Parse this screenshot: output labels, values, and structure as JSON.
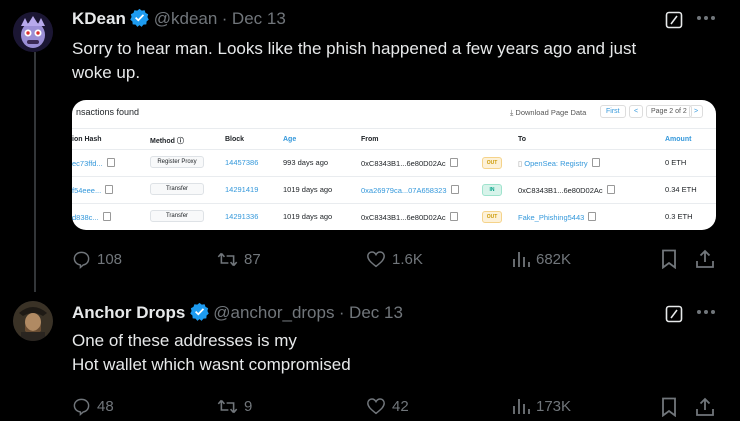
{
  "tweet1": {
    "name": "KDean",
    "handle": "@kdean",
    "separator": "·",
    "date": "Dec 13",
    "text_line1": "Sorry to hear man. Looks like the phish happened a few years ago and just",
    "text_line2": "woke up.",
    "replies": "108",
    "retweets": "87",
    "likes": "1.6K",
    "views": "682K"
  },
  "tweet2": {
    "name": "Anchor Drops",
    "handle": "@anchor_drops",
    "separator": "·",
    "date": "Dec 13",
    "text_line1": "One of these addresses is my",
    "text_line2": "Hot wallet which wasnt compromised",
    "replies": "48",
    "retweets": "9",
    "likes": "42",
    "views": "173K"
  },
  "embed": {
    "title": "nsactions found",
    "download": "Download Page Data",
    "first": "First",
    "prev": "<",
    "page": "Page 2 of 2",
    "next": ">",
    "headers": {
      "hash": "ion Hash",
      "method": "Method ⓘ",
      "block": "Block",
      "age": "Age",
      "from": "From",
      "to": "To",
      "amount": "Amount"
    },
    "rows": [
      {
        "hash": "ec73ffd...",
        "method": "Register Proxy",
        "block": "14457386",
        "age": "993 days ago",
        "from": "0xC8343B1...6e80D02Ac",
        "dir": "OUT",
        "to": "OpenSea: Registry",
        "amount": "0 ETH"
      },
      {
        "hash": "f54eee...",
        "method": "Transfer",
        "block": "14291419",
        "age": "1019 days ago",
        "from": "0xa26979ca...07A658323",
        "dir": "IN",
        "to": "0xC8343B1...6e80D02Ac",
        "amount": "0.34 ETH"
      },
      {
        "hash": "d838c...",
        "method": "Transfer",
        "block": "14291336",
        "age": "1019 days ago",
        "from": "0xC8343B1...6e80D02Ac",
        "dir": "OUT",
        "to": "Fake_Phishing5443",
        "amount": "0.3 ETH"
      }
    ]
  },
  "colors": {
    "background": "#000000",
    "text": "#e7e9ea",
    "muted": "#71767b",
    "verified": "#1d9bf0",
    "link": "#3498db"
  },
  "icons": [
    "verified-badge-icon",
    "grok-icon",
    "more-icon",
    "reply-icon",
    "retweet-icon",
    "like-icon",
    "views-icon",
    "bookmark-icon",
    "share-icon"
  ]
}
